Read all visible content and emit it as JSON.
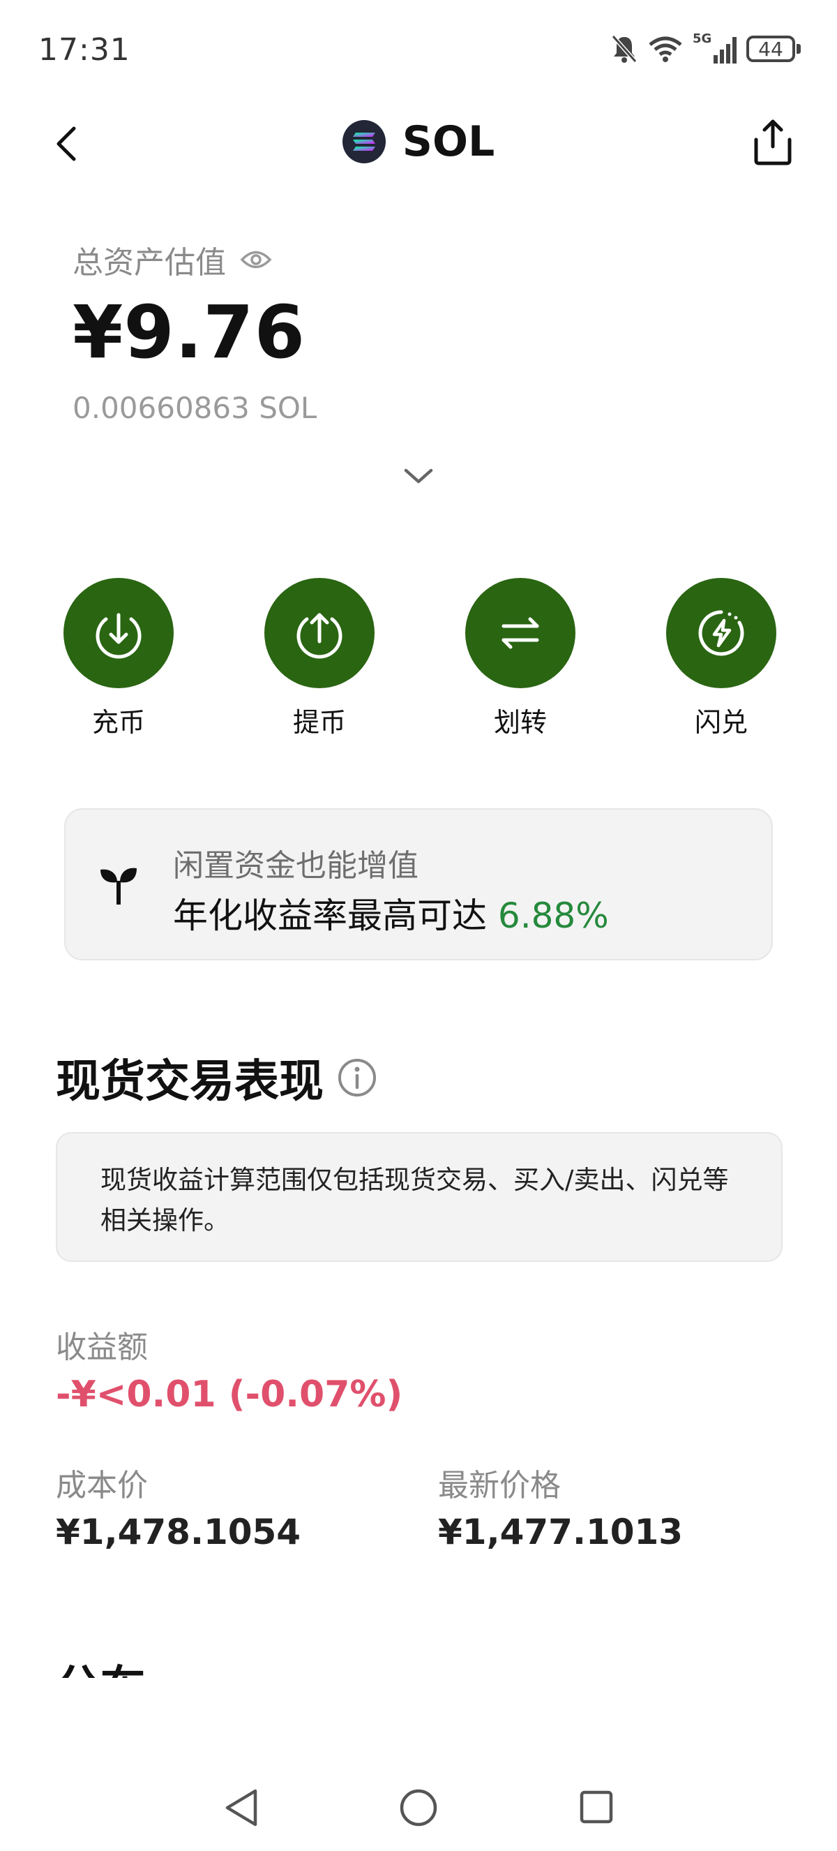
{
  "status_bar": {
    "time": "17:31",
    "battery": "44",
    "network": "5G",
    "icons": [
      "mute-bell-icon",
      "wifi-icon",
      "signal-icon",
      "battery-icon"
    ]
  },
  "header": {
    "title": "SOL",
    "back_icon": "chevron-left-icon",
    "share_icon": "share-icon",
    "coin_icon": "solana-logo-icon"
  },
  "balance": {
    "label": "总资产估值",
    "value": "¥9.76",
    "amount": "0.00660863 SOL"
  },
  "actions": [
    {
      "label": "充币",
      "icon": "deposit-icon"
    },
    {
      "label": "提币",
      "icon": "withdraw-icon"
    },
    {
      "label": "划转",
      "icon": "transfer-icon"
    },
    {
      "label": "闪兑",
      "icon": "flash-swap-icon"
    }
  ],
  "promo": {
    "subtitle": "闲置资金也能增值",
    "main_text": "年化收益率最高可达 ",
    "rate": "6.88%",
    "icon": "sprout-icon"
  },
  "spot_performance": {
    "title": "现货交易表现",
    "note": "现货收益计算范围仅包括现货交易、买入/卖出、闪兑等相关操作。",
    "pnl_label": "收益额",
    "pnl_value": "-¥<0.01 (-0.07%)",
    "cost_label": "成本价",
    "cost_value": "¥1,478.1054",
    "latest_label": "最新价格",
    "latest_value": "¥1,477.1013"
  },
  "next_section_title": "分布",
  "colors": {
    "action_green": "#2a6512",
    "rate_green": "#25893c",
    "loss_red": "#e0506c"
  }
}
